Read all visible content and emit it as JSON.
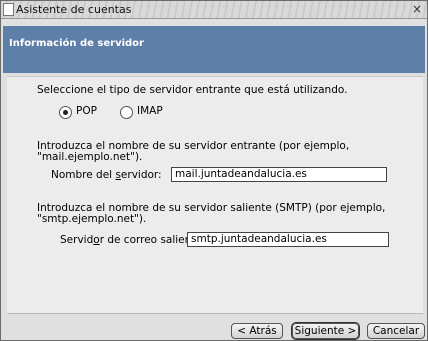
{
  "window": {
    "title": "Asistente de cuentas",
    "close_symbol": "×"
  },
  "header": {
    "title": "Información de servidor"
  },
  "server_type": {
    "prompt": "Seleccione el tipo de servidor entrante que está utilizando.",
    "options": [
      {
        "label": "POP",
        "selected": true
      },
      {
        "label": "IMAP",
        "selected": false
      }
    ]
  },
  "incoming": {
    "help_line1": "Introduzca el nombre de su servidor entrante (por ejemplo,",
    "help_line2": "\"mail.ejemplo.net\").",
    "label_prefix": "Nombre del ",
    "label_accel": "s",
    "label_suffix": "ervidor:",
    "value": "mail.juntadeandalucia.es"
  },
  "outgoing": {
    "help_line1": "Introduzca el nombre de su servidor saliente (SMTP) (por ejemplo,",
    "help_line2": "\"smtp.ejemplo.net\").",
    "label_prefix": "Servid",
    "label_accel": "o",
    "label_suffix": "r de correo saliente:",
    "value": "smtp.juntadeandalucia.es"
  },
  "buttons": {
    "back": "< Atrás",
    "next": "Siguiente >",
    "cancel": "Cancelar"
  }
}
